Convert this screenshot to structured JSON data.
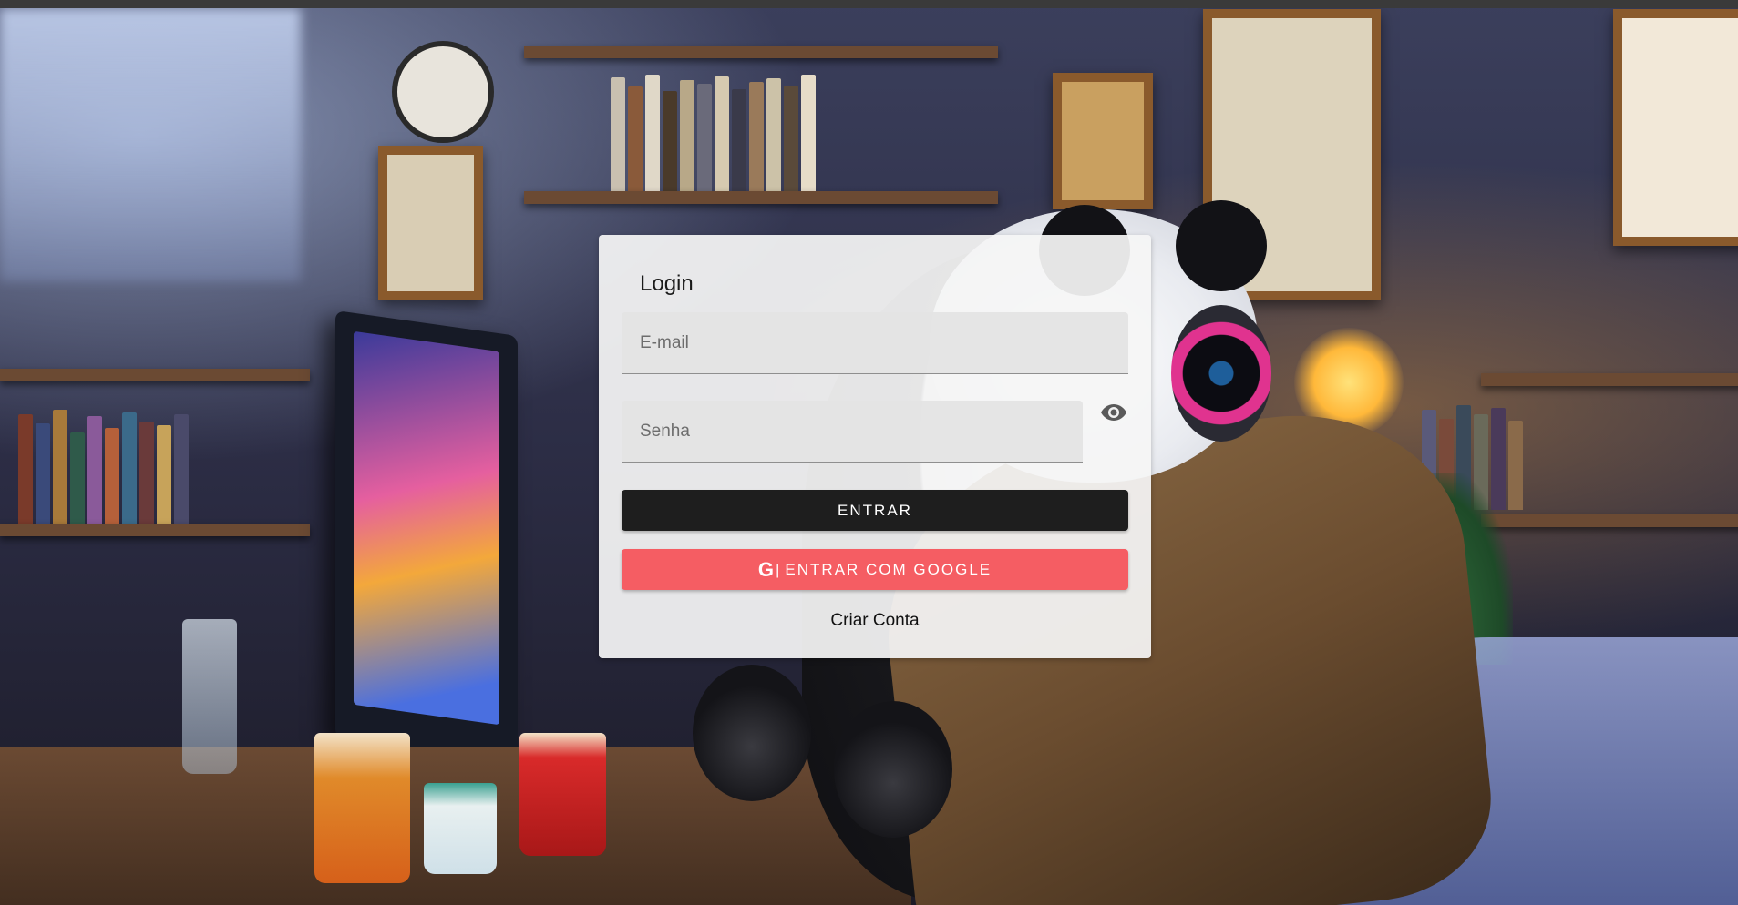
{
  "login": {
    "title": "Login",
    "email_placeholder": "E-mail",
    "password_placeholder": "Senha",
    "enter_button": "ENTRAR",
    "google_icon": "G",
    "google_separator": "|",
    "google_button": "ENTRAR COM GOOGLE",
    "create_account": "Criar Conta"
  },
  "icons": {
    "password_toggle": "eye-icon",
    "google": "google-icon"
  },
  "colors": {
    "enter_button": "#1e1e1e",
    "google_button": "#f55d63",
    "card_background": "#f5f5f5"
  }
}
